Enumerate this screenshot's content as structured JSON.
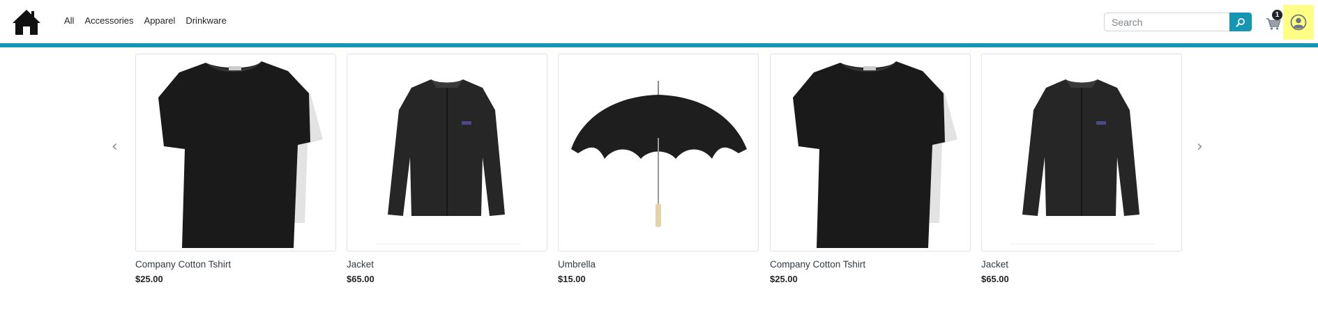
{
  "nav": {
    "links": [
      "All",
      "Accessories",
      "Apparel",
      "Drinkware"
    ]
  },
  "search": {
    "placeholder": "Search",
    "value": ""
  },
  "cart": {
    "count": "1"
  },
  "colors": {
    "accent": "#1596b3",
    "highlight": "#ffff85"
  },
  "carousel": {
    "prev_label": "‹",
    "next_label": "›",
    "products": [
      {
        "name": "Company Cotton Tshirt",
        "price": "$25.00",
        "image": "tshirt"
      },
      {
        "name": "Jacket",
        "price": "$65.00",
        "image": "jacket"
      },
      {
        "name": "Umbrella",
        "price": "$15.00",
        "image": "umbrella"
      },
      {
        "name": "Company Cotton Tshirt",
        "price": "$25.00",
        "image": "tshirt"
      },
      {
        "name": "Jacket",
        "price": "$65.00",
        "image": "jacket"
      }
    ]
  }
}
